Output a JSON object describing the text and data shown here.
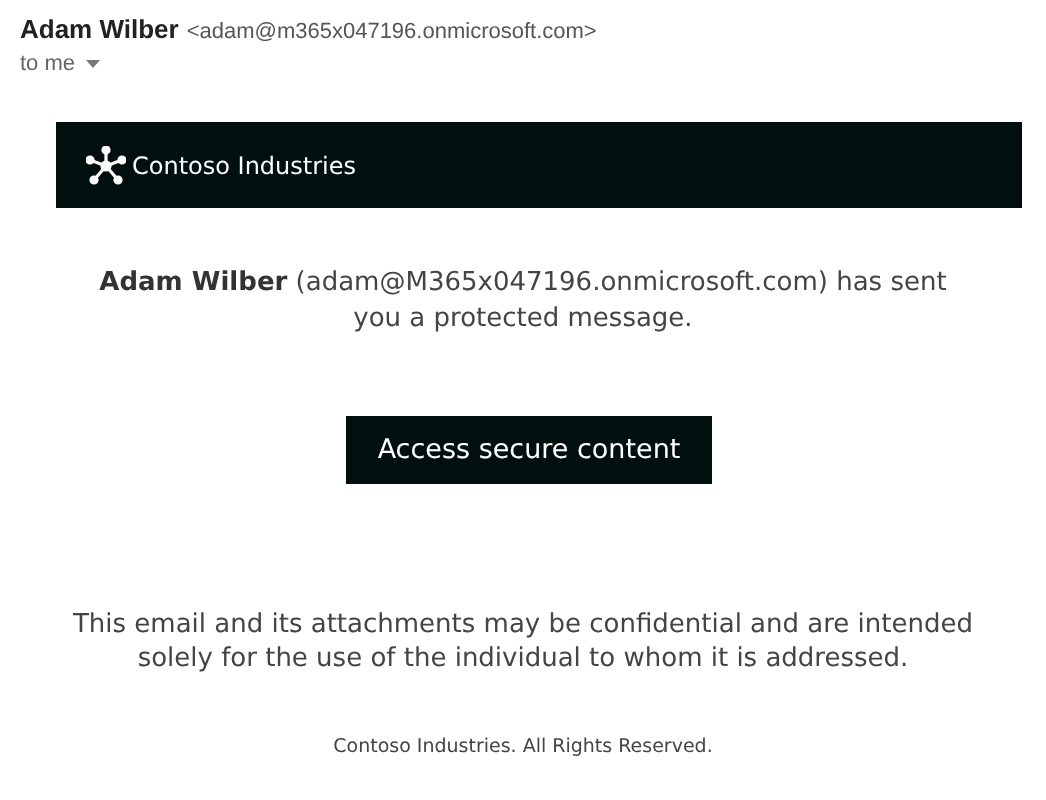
{
  "header": {
    "sender_name": "Adam Wilber",
    "sender_email": "<adam@m365x047196.onmicrosoft.com>",
    "recipient": "to me"
  },
  "banner": {
    "company": "Contoso Industries"
  },
  "message": "**Adam Wilber** (adam@M365x047196.onmicrosoft.com) has sent you a protected message.",
  "button": "Access secure content",
  "disclaimer": "This email and its attachments may be confidential and are intended solely for the use of the individual to whom it is addressed.",
  "footer": "Contoso Industries. All Rights Reserved."
}
